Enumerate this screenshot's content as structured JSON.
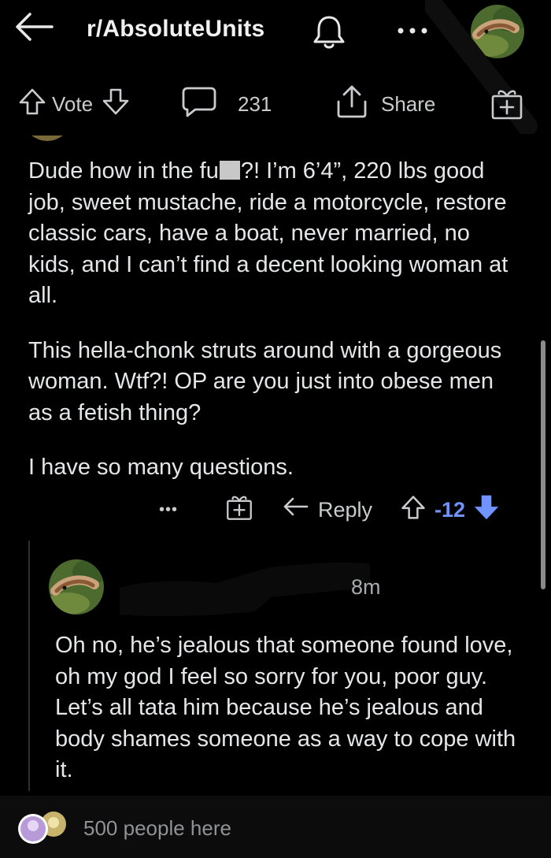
{
  "header": {
    "subreddit": "r/AbsoluteUnits",
    "icons": [
      "back-arrow-icon",
      "bell-icon",
      "more-dots-icon",
      "user-avatar"
    ]
  },
  "post_actions": {
    "vote_label": "Vote",
    "comment_count": "231",
    "share_label": "Share"
  },
  "comment": {
    "paragraphs": [
      {
        "before": "Dude how in the fu",
        "after": "?! I’m 6’4”, 220 lbs good job, sweet mustache, ride a motorcycle, restore classic cars, have a boat, never married, no kids, and I can’t find a decent looking woman at all."
      },
      "This hella-chonk struts around with a gorgeous woman. Wtf?! OP are you just into obese men as a fetish thing?",
      "I have so many questions."
    ],
    "actions": {
      "more": "•••",
      "reply_label": "Reply",
      "score": "-12"
    }
  },
  "reply": {
    "time": "8m",
    "body": "Oh no, he’s jealous that someone found love, oh my god I feel so sorry for you, poor guy. Let’s all tata him because he’s jealous and body shames someone as a way to cope with it."
  },
  "footer": {
    "presence": "500 people here"
  },
  "colors": {
    "background": "#000000",
    "text": "#e4e6e8",
    "muted": "#a8aaad",
    "downvote": "#7193ff"
  }
}
